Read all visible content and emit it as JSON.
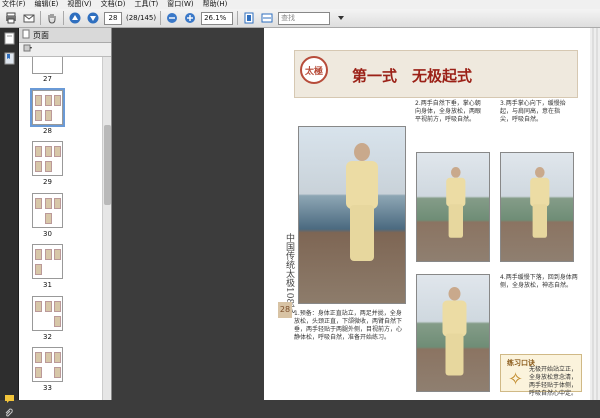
{
  "menubar": {
    "items": [
      "文件(F)",
      "编辑(E)",
      "视图(V)",
      "文档(D)",
      "工具(T)",
      "窗口(W)",
      "帮助(H)"
    ]
  },
  "toolbar": {
    "page_current": "28",
    "page_count": "(28/145)",
    "zoom": "26.1%",
    "search_placeholder": "查找"
  },
  "navigator": {
    "title": "页面",
    "thumbnails": [
      {
        "label": "27"
      },
      {
        "label": "28"
      },
      {
        "label": "29"
      },
      {
        "label": "30"
      },
      {
        "label": "31"
      },
      {
        "label": "32"
      },
      {
        "label": "33"
      }
    ]
  },
  "page": {
    "header_seal": "太極",
    "title": "第一式　无极起式",
    "side_book_title": "中国传统太极108式",
    "page_number": "28",
    "text_block_1": "2.两手自然下垂，掌心朝向身体，全身放松，两眼平视前方，呼吸自然。",
    "text_block_2": "3.两手掌心向下，缓慢抬起，与肩同高，意在指尖，呼吸自然。",
    "text_block_3": "4.两手缓慢下落，回到身体两侧，全身放松，神态自然。",
    "bottom_text": "1.预备：身体正直站立，两足并拢，全身放松，头颈正直，下颌微收，两臂自然下垂，两手轻贴于两腿外侧，目视前方，心静体松，呼吸自然，准备开始练习。",
    "memo_title": "练习口诀",
    "memo_text": "无极开始站立正，全身放松意念清，两手轻贴于体侧，呼吸自然心中定。"
  }
}
